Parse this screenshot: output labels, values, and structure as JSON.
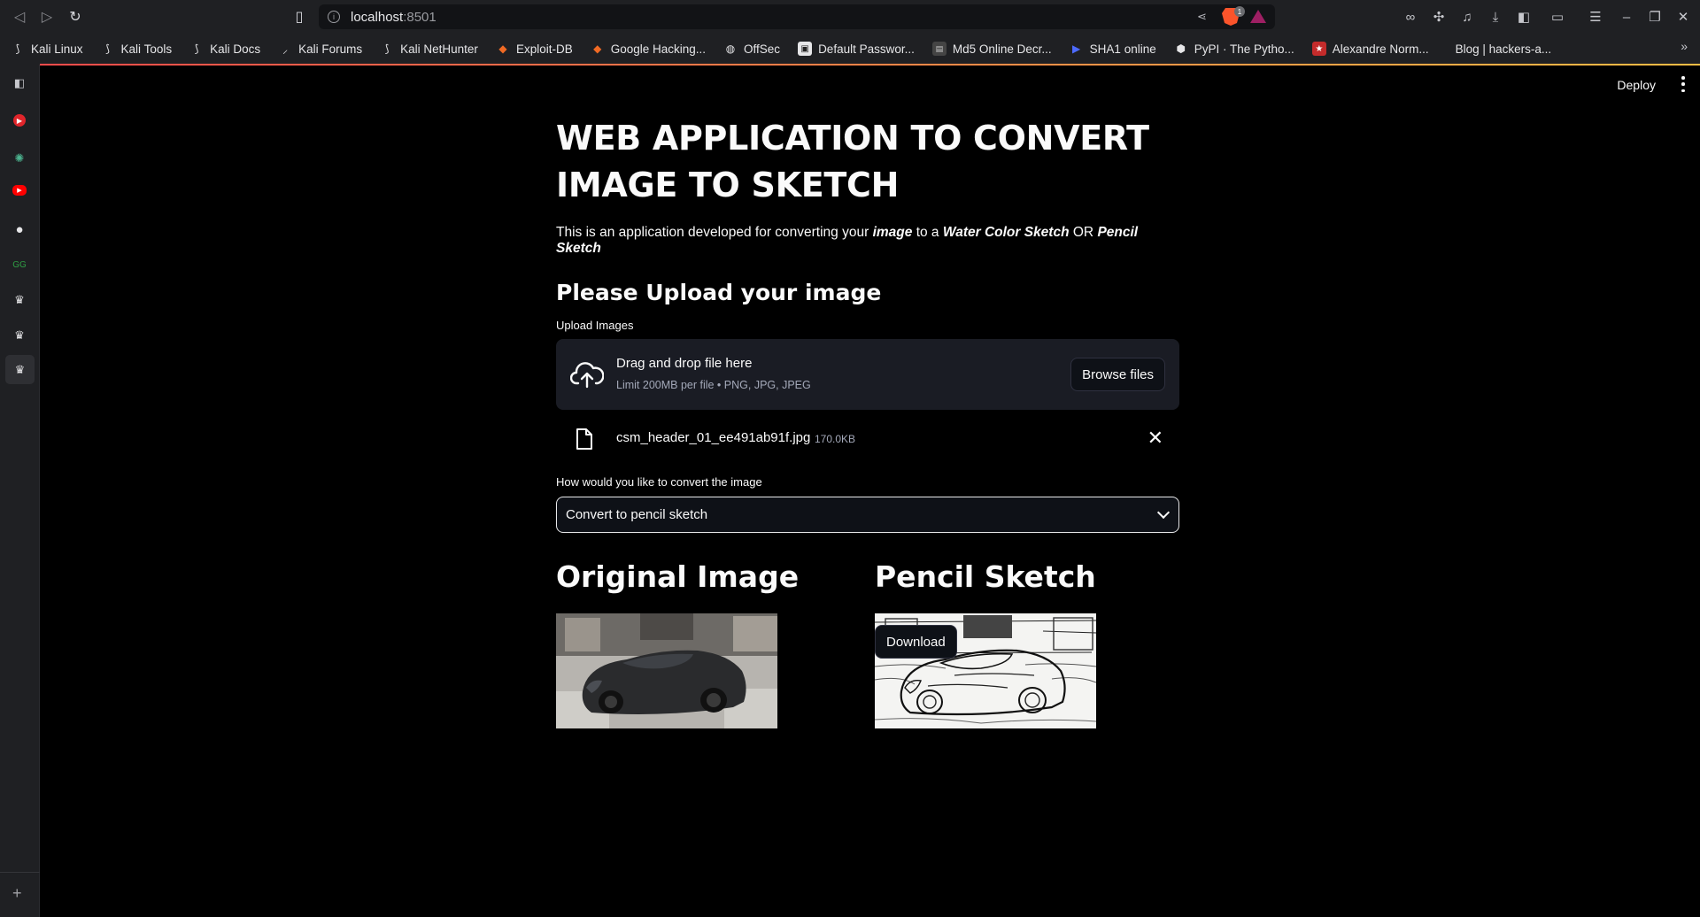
{
  "browser": {
    "url_host": "localhost",
    "url_port": ":8501",
    "bookmarks": [
      {
        "label": "Kali Linux",
        "icon": "kali-dragon-icon"
      },
      {
        "label": "Kali Tools",
        "icon": "kali-dragon-icon"
      },
      {
        "label": "Kali Docs",
        "icon": "kali-dragon-icon"
      },
      {
        "label": "Kali Forums",
        "icon": "kali-forums-icon"
      },
      {
        "label": "Kali NetHunter",
        "icon": "kali-dragon-icon"
      },
      {
        "label": "Exploit-DB",
        "icon": "exploit-db-icon"
      },
      {
        "label": "Google Hacking...",
        "icon": "google-hacking-icon"
      },
      {
        "label": "OffSec",
        "icon": "offsec-icon"
      },
      {
        "label": "Default Passwor...",
        "icon": "default-password-icon"
      },
      {
        "label": "Md5 Online Decr...",
        "icon": "md5-icon"
      },
      {
        "label": "SHA1 online",
        "icon": "sha1-icon"
      },
      {
        "label": "PyPI · The Pytho...",
        "icon": "pypi-icon"
      },
      {
        "label": "Alexandre Norm...",
        "icon": "star-icon"
      },
      {
        "label": "Blog | hackers-a...",
        "icon": ""
      }
    ],
    "brave_badge": "1",
    "more_bookmarks": "»"
  },
  "app": {
    "deploy_label": "Deploy",
    "title": "WEB APPLICATION TO CONVERT IMAGE TO SKETCH",
    "intro_prefix": "This is an application developed for converting your ",
    "intro_image": "image",
    "intro_mid": " to a ",
    "intro_water": "Water Color Sketch",
    "intro_or": " OR ",
    "intro_pencil": "Pencil Sketch",
    "upload_heading": "Please Upload your image",
    "upload_label": "Upload Images",
    "dropzone_title": "Drag and drop file here",
    "dropzone_limit": "Limit 200MB per file • PNG, JPG, JPEG",
    "browse_label": "Browse files",
    "file_name": "csm_header_01_ee491ab91f.jpg",
    "file_size": "170.0KB",
    "convert_label": "How would you like to convert the image",
    "convert_value": "Convert to pencil sketch",
    "original_heading": "Original Image",
    "sketch_heading": "Pencil Sketch",
    "download_label": "Download"
  }
}
